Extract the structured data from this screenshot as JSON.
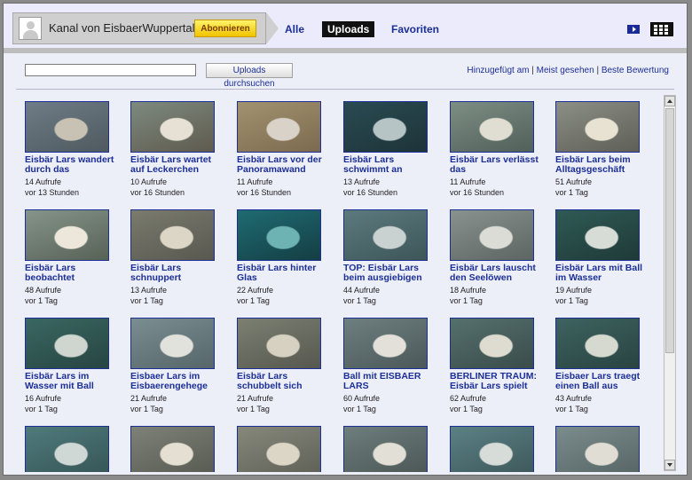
{
  "channel": {
    "name": "Kanal von EisbaerWuppertal",
    "subscribe_label": "Abonnieren"
  },
  "nav": {
    "all": "Alle",
    "uploads": "Uploads",
    "favorites": "Favoriten"
  },
  "icons": {
    "view_player": "player-view-icon",
    "view_grid": "grid-view-icon",
    "avatar": "default-avatar-icon"
  },
  "colors": {
    "link": "#1c2f95",
    "subscribe_bg": "#f5d31c",
    "active_nav_bg": "#111111"
  },
  "search": {
    "value": "",
    "button_label": "Uploads durchsuchen"
  },
  "sort": {
    "added": "Hinzugefügt am",
    "sep1": " | ",
    "most_viewed": "Meist gesehen",
    "sep2": " | ",
    "best_rated": "Beste Bewertung"
  },
  "videos": [
    {
      "title": "Eisbär Lars wandert durch das",
      "views": "14 Aufrufe",
      "age": "vor 13 Stunden",
      "thumb": [
        "#6f7c86",
        "#c8c2b4",
        "#4e5a5f"
      ]
    },
    {
      "title": "Eisbär Lars wartet auf Leckerchen",
      "views": "10 Aufrufe",
      "age": "vor 16 Stunden",
      "thumb": [
        "#7d8a7f",
        "#e7e1d5",
        "#5f5a4e"
      ]
    },
    {
      "title": "Eisbär Lars vor der Panoramawand",
      "views": "11 Aufrufe",
      "age": "vor 16 Stunden",
      "thumb": [
        "#a19270",
        "#d9d2c8",
        "#7c6a4e"
      ]
    },
    {
      "title": "Eisbär Lars schwimmt an",
      "views": "13 Aufrufe",
      "age": "vor 16 Stunden",
      "thumb": [
        "#2a4a52",
        "#b6c4c6",
        "#1d3439"
      ]
    },
    {
      "title": "Eisbär Lars verlässt das",
      "views": "11 Aufrufe",
      "age": "vor 16 Stunden",
      "thumb": [
        "#7d8e84",
        "#e0ddd2",
        "#50605a"
      ]
    },
    {
      "title": "Eisbär Lars beim Alltagsgeschäft",
      "views": "51 Aufrufe",
      "age": "vor 1 Tag",
      "thumb": [
        "#8c8f86",
        "#e8e2d2",
        "#5e5f57"
      ]
    },
    {
      "title": "Eisbär Lars beobachtet",
      "views": "48 Aufrufe",
      "age": "vor 1 Tag",
      "thumb": [
        "#869489",
        "#ece7da",
        "#576257"
      ]
    },
    {
      "title": "Eisbär Lars schnuppert",
      "views": "13 Aufrufe",
      "age": "vor 1 Tag",
      "thumb": [
        "#7a7b6e",
        "#dcd6c6",
        "#585850"
      ]
    },
    {
      "title": "Eisbär Lars hinter Glas",
      "views": "22 Aufrufe",
      "age": "vor 1 Tag",
      "thumb": [
        "#1f6b72",
        "#6db3b3",
        "#143e44"
      ]
    },
    {
      "title": "TOP: Eisbär Lars beim ausgiebigen",
      "views": "44 Aufrufe",
      "age": "vor 1 Tag",
      "thumb": [
        "#5c7a7e",
        "#c9d2d0",
        "#3d5658"
      ]
    },
    {
      "title": "Eisbär Lars lauscht den Seelöwen",
      "views": "18 Aufrufe",
      "age": "vor 1 Tag",
      "thumb": [
        "#8a9290",
        "#dcdcd6",
        "#5d6563"
      ]
    },
    {
      "title": "Eisbär Lars mit Ball im Wasser",
      "views": "19 Aufrufe",
      "age": "vor 1 Tag",
      "thumb": [
        "#2f5a55",
        "#d8dcd6",
        "#1f3a38"
      ]
    },
    {
      "title": "Eisbär Lars im Wasser mit Ball",
      "views": "16 Aufrufe",
      "age": "vor 1 Tag",
      "thumb": [
        "#3a6762",
        "#cfd6cf",
        "#274542"
      ]
    },
    {
      "title": "Eisbaer Lars im Eisbaerengehege",
      "views": "21 Aufrufe",
      "age": "vor 1 Tag",
      "thumb": [
        "#7a8d90",
        "#e1e2dc",
        "#56666a"
      ]
    },
    {
      "title": "Eisbär Lars schubbelt sich",
      "views": "21 Aufrufe",
      "age": "vor 1 Tag",
      "thumb": [
        "#7c7f72",
        "#d6d1c0",
        "#56584f"
      ]
    },
    {
      "title": "Ball mit EISBAER LARS",
      "views": "60 Aufrufe",
      "age": "vor 1 Tag",
      "thumb": [
        "#6e7f80",
        "#e2e0d8",
        "#4b5859"
      ]
    },
    {
      "title": "BERLINER TRAUM: Eisbär Lars spielt",
      "views": "62 Aufrufe",
      "age": "vor 1 Tag",
      "thumb": [
        "#55706d",
        "#dedbd0",
        "#3a4c4a"
      ]
    },
    {
      "title": "Eisbaer Lars traegt einen Ball aus",
      "views": "43 Aufrufe",
      "age": "vor 1 Tag",
      "thumb": [
        "#3d6360",
        "#d5d9cf",
        "#294341"
      ]
    },
    {
      "title": "",
      "views": "",
      "age": "",
      "thumb": [
        "#4f7a7c",
        "#cfd8d4",
        "#365556"
      ]
    },
    {
      "title": "",
      "views": "",
      "age": "",
      "thumb": [
        "#7e8177",
        "#e4dfd2",
        "#575a52"
      ]
    },
    {
      "title": "",
      "views": "",
      "age": "",
      "thumb": [
        "#86887c",
        "#dcd6c6",
        "#5e6056"
      ]
    },
    {
      "title": "",
      "views": "",
      "age": "",
      "thumb": [
        "#6d7e7c",
        "#e1dfd6",
        "#4a5655"
      ]
    },
    {
      "title": "",
      "views": "",
      "age": "",
      "thumb": [
        "#5b8185",
        "#d7dcd8",
        "#3d5759"
      ]
    },
    {
      "title": "",
      "views": "",
      "age": "",
      "thumb": [
        "#7b8c8c",
        "#e0ddd4",
        "#566464"
      ]
    }
  ]
}
